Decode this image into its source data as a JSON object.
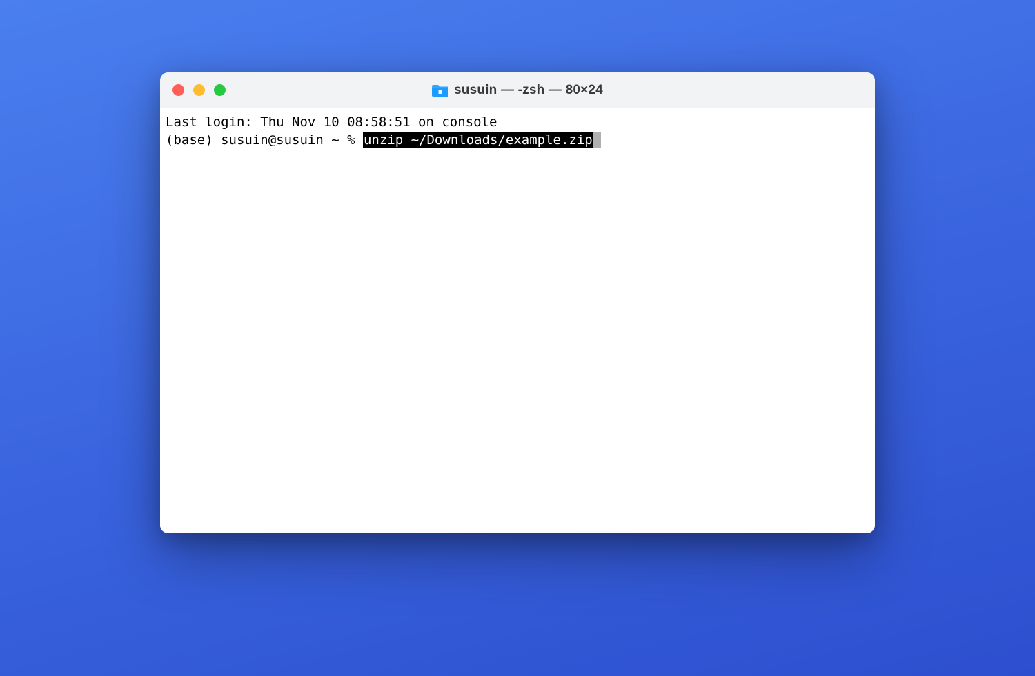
{
  "window": {
    "title": "susuin — -zsh — 80×24"
  },
  "terminal": {
    "last_login": "Last login: Thu Nov 10 08:58:51 on console",
    "prompt": "(base) susuin@susuin ~ % ",
    "command": "unzip ~/Downloads/example.zip"
  },
  "traffic_lights": {
    "close": "close-window",
    "minimize": "minimize-window",
    "maximize": "maximize-window"
  }
}
